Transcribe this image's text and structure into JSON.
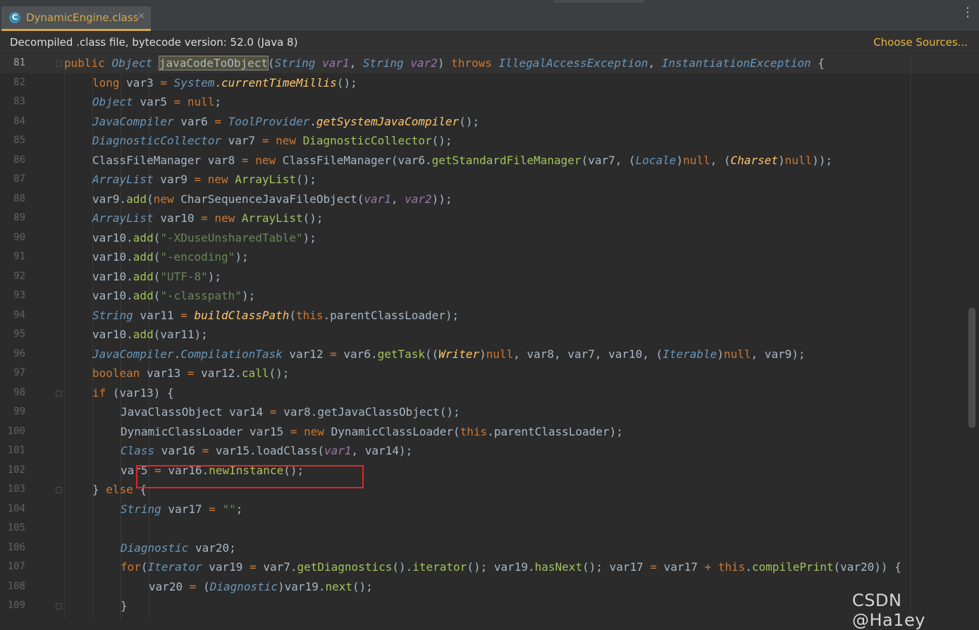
{
  "tab": {
    "icon": "C",
    "label": "DynamicEngine.class",
    "close": "✕"
  },
  "banner": {
    "text": "Decompiled .class file, bytecode version: 52.0 (Java 8)",
    "link": "Choose Sources..."
  },
  "menu_icon": "⋮",
  "watermark": "CSDN @Ha1ey",
  "lines": [
    {
      "n": "81",
      "cur": true,
      "tokens": [
        [
          "k",
          "public "
        ],
        [
          "t",
          "Object "
        ],
        [
          "hl",
          "javaCodeToObject"
        ],
        [
          "n",
          "("
        ],
        [
          "t",
          "String "
        ],
        [
          "p",
          "var1"
        ],
        [
          "n",
          ", "
        ],
        [
          "t",
          "String "
        ],
        [
          "p",
          "var2"
        ],
        [
          "n",
          ") "
        ],
        [
          "k",
          "throws "
        ],
        [
          "t",
          "IllegalAccessException"
        ],
        [
          "n",
          ", "
        ],
        [
          "t",
          "InstantiationException "
        ],
        [
          "n",
          "{"
        ]
      ],
      "indent": 2
    },
    {
      "n": "82",
      "tokens": [
        [
          "k",
          "long "
        ],
        [
          "n",
          "var3 "
        ],
        [
          "k",
          "= "
        ],
        [
          "t",
          "System"
        ],
        [
          "n",
          "."
        ],
        [
          "m",
          "currentTimeMillis"
        ],
        [
          "n",
          "();"
        ]
      ],
      "indent": 3
    },
    {
      "n": "83",
      "tokens": [
        [
          "t",
          "Object "
        ],
        [
          "n",
          "var5 "
        ],
        [
          "k",
          "= null"
        ],
        [
          "n",
          ";"
        ]
      ],
      "indent": 3
    },
    {
      "n": "84",
      "tokens": [
        [
          "t",
          "JavaCompiler "
        ],
        [
          "n",
          "var6 "
        ],
        [
          "k",
          "= "
        ],
        [
          "t",
          "ToolProvider"
        ],
        [
          "n",
          "."
        ],
        [
          "m",
          "getSystemJavaCompiler"
        ],
        [
          "n",
          "();"
        ]
      ],
      "indent": 3
    },
    {
      "n": "85",
      "tokens": [
        [
          "t",
          "DiagnosticCollector "
        ],
        [
          "n",
          "var7 "
        ],
        [
          "k",
          "= new "
        ],
        [
          "fn",
          "DiagnosticCollector"
        ],
        [
          "n",
          "();"
        ]
      ],
      "indent": 3
    },
    {
      "n": "86",
      "tokens": [
        [
          "n",
          "ClassFileManager var8 "
        ],
        [
          "k",
          "= new "
        ],
        [
          "n",
          "ClassFileManager(var6."
        ],
        [
          "fn",
          "getStandardFileManager"
        ],
        [
          "n",
          "(var7, ("
        ],
        [
          "t",
          "Locale"
        ],
        [
          "n",
          ")"
        ],
        [
          "k",
          "null"
        ],
        [
          "n",
          ", ("
        ],
        [
          "m",
          "Charset"
        ],
        [
          "n",
          ")"
        ],
        [
          "k",
          "null"
        ],
        [
          "n",
          "));"
        ]
      ],
      "indent": 3
    },
    {
      "n": "87",
      "tokens": [
        [
          "t",
          "ArrayList "
        ],
        [
          "n",
          "var9 "
        ],
        [
          "k",
          "= new "
        ],
        [
          "fn",
          "ArrayList"
        ],
        [
          "n",
          "();"
        ]
      ],
      "indent": 3
    },
    {
      "n": "88",
      "tokens": [
        [
          "n",
          "var9."
        ],
        [
          "fn",
          "add"
        ],
        [
          "n",
          "("
        ],
        [
          "k",
          "new "
        ],
        [
          "n",
          "CharSequenceJavaFileObject("
        ],
        [
          "p",
          "var1"
        ],
        [
          "n",
          ", "
        ],
        [
          "p",
          "var2"
        ],
        [
          "n",
          "));"
        ]
      ],
      "indent": 3
    },
    {
      "n": "89",
      "tokens": [
        [
          "t",
          "ArrayList "
        ],
        [
          "n",
          "var10 "
        ],
        [
          "k",
          "= new "
        ],
        [
          "fn",
          "ArrayList"
        ],
        [
          "n",
          "();"
        ]
      ],
      "indent": 3
    },
    {
      "n": "90",
      "tokens": [
        [
          "n",
          "var10."
        ],
        [
          "fn",
          "add"
        ],
        [
          "n",
          "("
        ],
        [
          "s",
          "\"-XDuseUnsharedTable\""
        ],
        [
          "n",
          ");"
        ]
      ],
      "indent": 3
    },
    {
      "n": "91",
      "tokens": [
        [
          "n",
          "var10."
        ],
        [
          "fn",
          "add"
        ],
        [
          "n",
          "("
        ],
        [
          "s",
          "\"-encoding\""
        ],
        [
          "n",
          ");"
        ]
      ],
      "indent": 3
    },
    {
      "n": "92",
      "tokens": [
        [
          "n",
          "var10."
        ],
        [
          "fn",
          "add"
        ],
        [
          "n",
          "("
        ],
        [
          "s",
          "\"UTF-8\""
        ],
        [
          "n",
          ");"
        ]
      ],
      "indent": 3
    },
    {
      "n": "93",
      "tokens": [
        [
          "n",
          "var10."
        ],
        [
          "fn",
          "add"
        ],
        [
          "n",
          "("
        ],
        [
          "s",
          "\"-classpath\""
        ],
        [
          "n",
          ");"
        ]
      ],
      "indent": 3
    },
    {
      "n": "94",
      "tokens": [
        [
          "t",
          "String "
        ],
        [
          "n",
          "var11 "
        ],
        [
          "k",
          "= "
        ],
        [
          "m",
          "buildClassPath"
        ],
        [
          "n",
          "("
        ],
        [
          "k",
          "this"
        ],
        [
          "n",
          ".parentClassLoader);"
        ]
      ],
      "indent": 3
    },
    {
      "n": "95",
      "tokens": [
        [
          "n",
          "var10."
        ],
        [
          "fn",
          "add"
        ],
        [
          "n",
          "(var11);"
        ]
      ],
      "indent": 3
    },
    {
      "n": "96",
      "tokens": [
        [
          "t",
          "JavaCompiler"
        ],
        [
          "n",
          "."
        ],
        [
          "t",
          "CompilationTask "
        ],
        [
          "n",
          "var12 "
        ],
        [
          "k",
          "= "
        ],
        [
          "n",
          "var6."
        ],
        [
          "fn",
          "getTask"
        ],
        [
          "n",
          "(("
        ],
        [
          "m",
          "Writer"
        ],
        [
          "n",
          ")"
        ],
        [
          "k",
          "null"
        ],
        [
          "n",
          ", var8, var7, var10, ("
        ],
        [
          "t",
          "Iterable"
        ],
        [
          "n",
          ")"
        ],
        [
          "k",
          "null"
        ],
        [
          "n",
          ", var9);"
        ]
      ],
      "indent": 3
    },
    {
      "n": "97",
      "tokens": [
        [
          "k",
          "boolean "
        ],
        [
          "n",
          "var13 "
        ],
        [
          "k",
          "= "
        ],
        [
          "n",
          "var12."
        ],
        [
          "fn",
          "call"
        ],
        [
          "n",
          "();"
        ]
      ],
      "indent": 3
    },
    {
      "n": "98",
      "tokens": [
        [
          "k",
          "if "
        ],
        [
          "n",
          "(var13) {"
        ]
      ],
      "indent": 3
    },
    {
      "n": "99",
      "tokens": [
        [
          "n",
          "JavaClassObject var14 "
        ],
        [
          "k",
          "= "
        ],
        [
          "n",
          "var8.getJavaClassObject();"
        ]
      ],
      "indent": 4
    },
    {
      "n": "100",
      "tokens": [
        [
          "n",
          "DynamicClassLoader var15 "
        ],
        [
          "k",
          "= new "
        ],
        [
          "n",
          "DynamicClassLoader("
        ],
        [
          "k",
          "this"
        ],
        [
          "n",
          ".parentClassLoader);"
        ]
      ],
      "indent": 4
    },
    {
      "n": "101",
      "tokens": [
        [
          "t",
          "Class "
        ],
        [
          "n",
          "var16 "
        ],
        [
          "k",
          "= "
        ],
        [
          "n",
          "var15.loadClass("
        ],
        [
          "p",
          "var1"
        ],
        [
          "n",
          ", var14);"
        ]
      ],
      "indent": 4
    },
    {
      "n": "102",
      "tokens": [
        [
          "n",
          "var5 "
        ],
        [
          "k",
          "= "
        ],
        [
          "n",
          "var16."
        ],
        [
          "fn",
          "newInstance"
        ],
        [
          "n",
          "();"
        ]
      ],
      "indent": 4
    },
    {
      "n": "103",
      "tokens": [
        [
          "n",
          "} "
        ],
        [
          "k",
          "else "
        ],
        [
          "n",
          "{"
        ]
      ],
      "indent": 3
    },
    {
      "n": "104",
      "tokens": [
        [
          "t",
          "String "
        ],
        [
          "n",
          "var17 "
        ],
        [
          "k",
          "= "
        ],
        [
          "s",
          "\"\""
        ],
        [
          "n",
          ";"
        ]
      ],
      "indent": 4
    },
    {
      "n": "105",
      "tokens": [],
      "indent": 4
    },
    {
      "n": "106",
      "tokens": [
        [
          "t",
          "Diagnostic "
        ],
        [
          "n",
          "var20;"
        ]
      ],
      "indent": 4
    },
    {
      "n": "107",
      "tokens": [
        [
          "k",
          "for"
        ],
        [
          "n",
          "("
        ],
        [
          "t",
          "Iterator "
        ],
        [
          "n",
          "var19 "
        ],
        [
          "k",
          "= "
        ],
        [
          "n",
          "var7."
        ],
        [
          "fn",
          "getDiagnostics"
        ],
        [
          "n",
          "()."
        ],
        [
          "fn",
          "iterator"
        ],
        [
          "n",
          "(); var19."
        ],
        [
          "fn",
          "hasNext"
        ],
        [
          "n",
          "(); var17 "
        ],
        [
          "k",
          "= "
        ],
        [
          "n",
          "var17 "
        ],
        [
          "k",
          "+ this"
        ],
        [
          "n",
          "."
        ],
        [
          "fn",
          "compilePrint"
        ],
        [
          "n",
          "(var20)) {"
        ]
      ],
      "indent": 4
    },
    {
      "n": "108",
      "tokens": [
        [
          "n",
          "var20 "
        ],
        [
          "k",
          "= "
        ],
        [
          "n",
          "("
        ],
        [
          "t",
          "Diagnostic"
        ],
        [
          "n",
          ")var19."
        ],
        [
          "fn",
          "next"
        ],
        [
          "n",
          "();"
        ]
      ],
      "indent": 5
    },
    {
      "n": "109",
      "tokens": [
        [
          "n",
          "}"
        ]
      ],
      "indent": 4
    }
  ]
}
